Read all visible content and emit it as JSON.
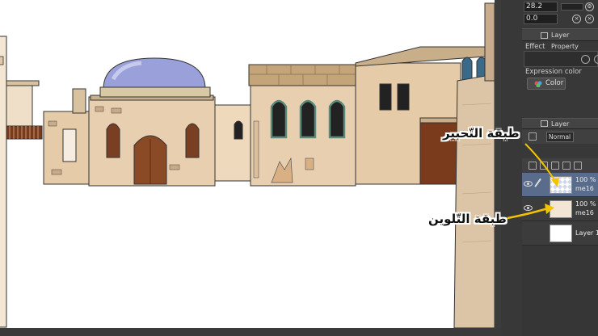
{
  "tool_property": {
    "value_1": "28.2",
    "value_2": "0.0",
    "tab_label": "Layer Property",
    "effect_label": "Effect",
    "expression_color_label": "Expression color",
    "color_select_value": "Color"
  },
  "layer_panel": {
    "tab_label": "Layer",
    "blend_mode": "Normal",
    "layers": [
      {
        "opacity": "100 %",
        "name": "me16",
        "extra": "2"
      },
      {
        "opacity": "100 %",
        "name": "me16",
        "extra": "C"
      },
      {
        "name": "Layer 1"
      }
    ]
  },
  "annotations": {
    "inking_layer": "طبقة التّحبير",
    "coloring_layer": "طبقة التّلوين"
  },
  "colors": {
    "annotation_arrow": "#f2c400",
    "selected_layer": "#5a6c8c",
    "panel_bg": "#383838",
    "wall_main": "#e8cfb0",
    "dome": "#8a8fd0"
  },
  "icons": [
    "eye-icon",
    "pen-icon",
    "layer-property-icon",
    "layer-tab-icon",
    "color-wheel-icon"
  ]
}
